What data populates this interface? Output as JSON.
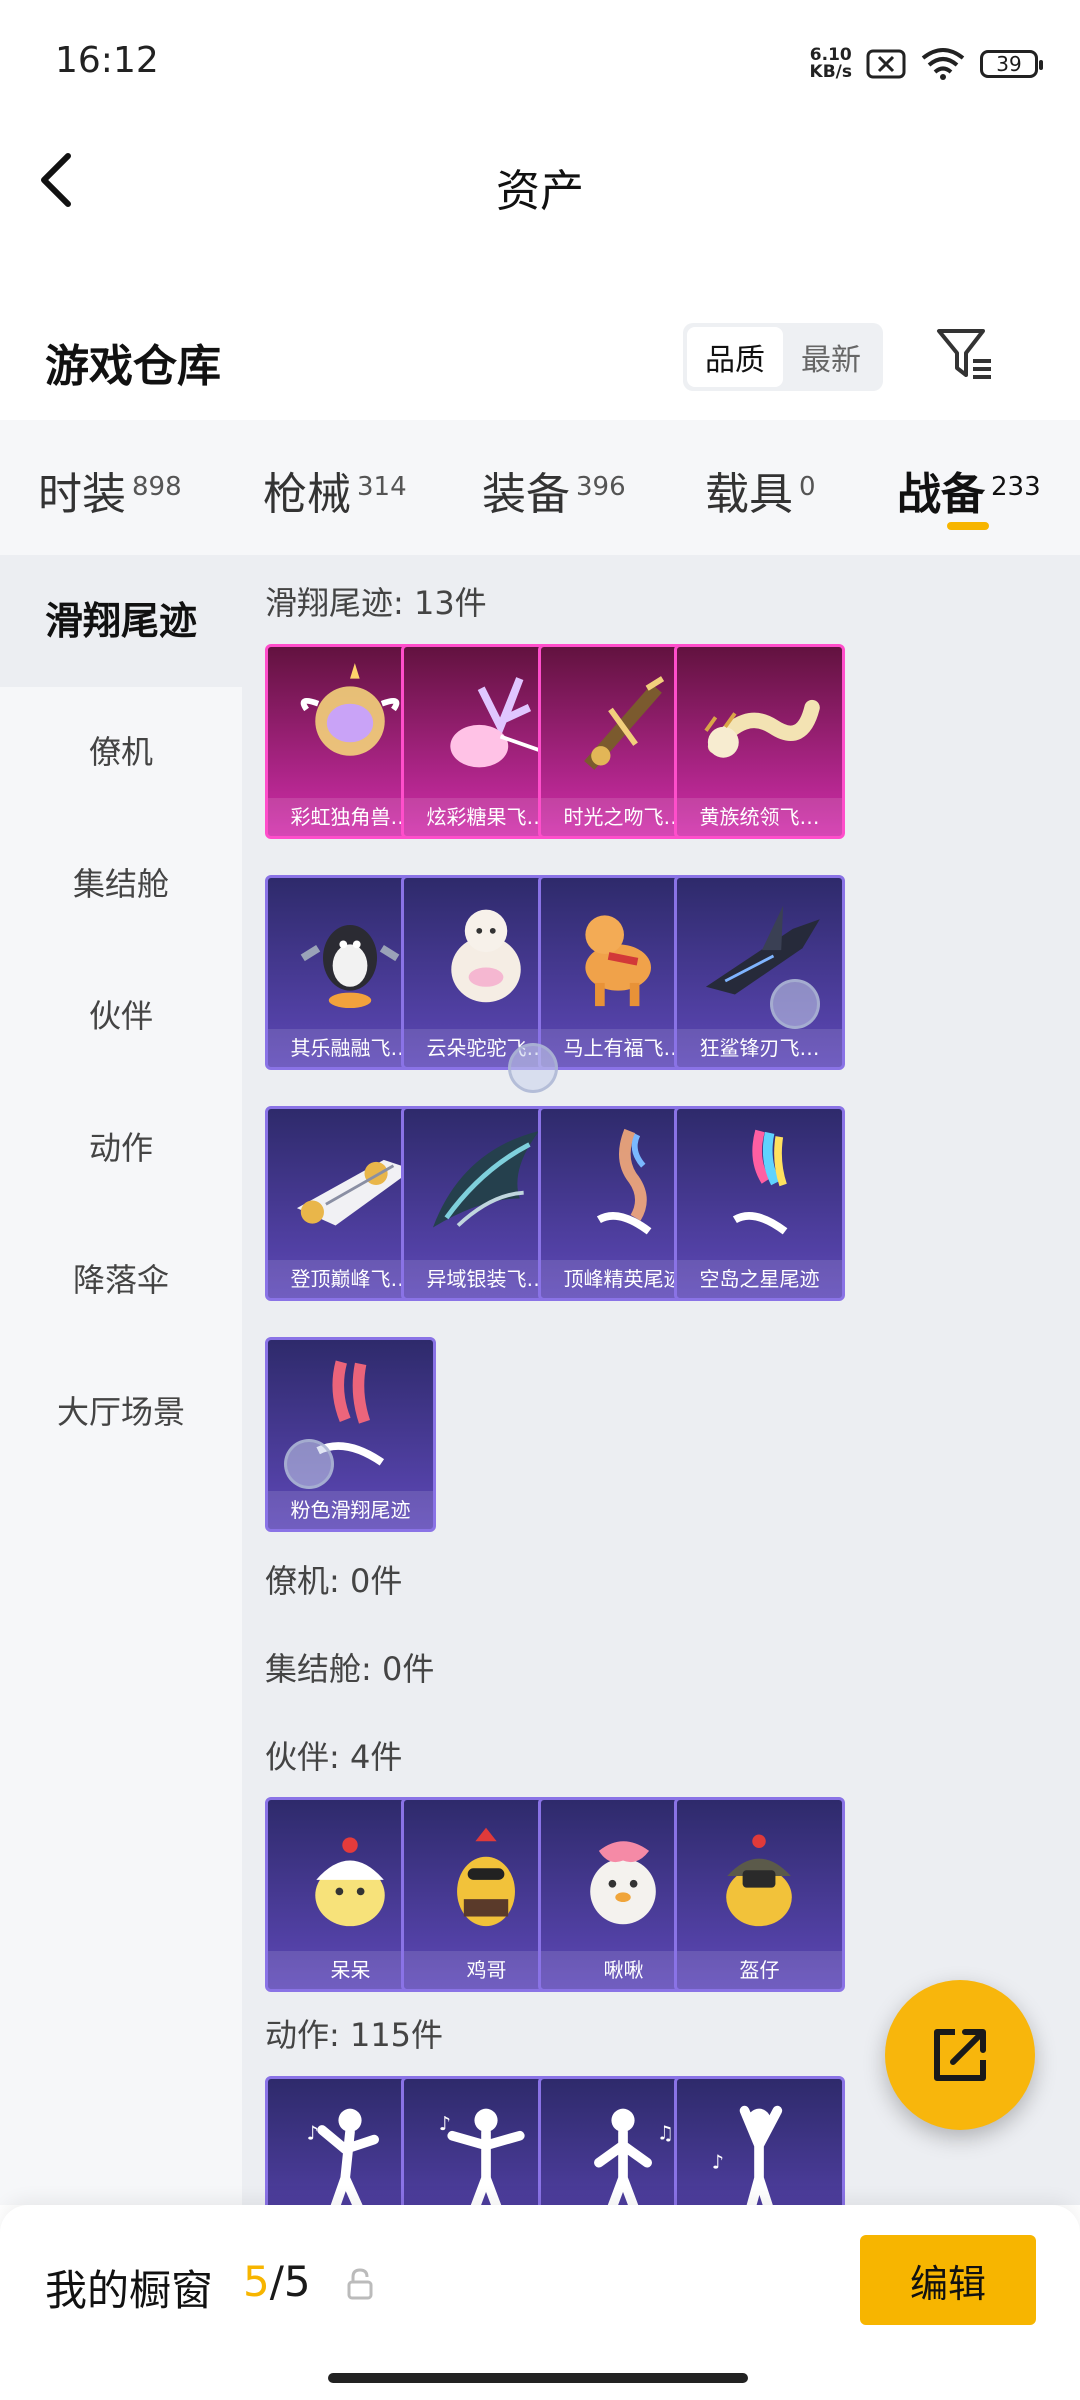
{
  "status_bar": {
    "time": "16:12",
    "net_speed_value": "6.10",
    "net_speed_unit": "KB/s",
    "battery": "39"
  },
  "header": {
    "title": "资产"
  },
  "warehouse": {
    "title": "游戏仓库",
    "sort_options": [
      "品质",
      "最新"
    ],
    "active_sort": "品质"
  },
  "category_tabs": [
    {
      "label": "时装",
      "count": "898"
    },
    {
      "label": "枪械",
      "count": "314"
    },
    {
      "label": "装备",
      "count": "396"
    },
    {
      "label": "载具",
      "count": "0"
    },
    {
      "label": "战备",
      "count": "233",
      "active": true
    }
  ],
  "sidebar": {
    "items": [
      "滑翔尾迹",
      "僚机",
      "集结舱",
      "伙伴",
      "动作",
      "降落伞",
      "大厅场景"
    ],
    "active": "滑翔尾迹"
  },
  "sections": {
    "glide_trail": {
      "header": "滑翔尾迹: 13件",
      "items": [
        "彩虹独角兽…",
        "炫彩糖果飞…",
        "时光之吻飞…",
        "黄族统领飞…",
        "其乐融融飞…",
        "云朵驼驼飞…",
        "马上有福飞…",
        "狂鲨锋刃飞…",
        "登顶巅峰飞…",
        "异域银装飞…",
        "顶峰精英尾迹",
        "空岛之星尾迹",
        "粉色滑翔尾迹"
      ]
    },
    "wingman": {
      "header": "僚机: 0件"
    },
    "capsule": {
      "header": "集结舱: 0件"
    },
    "companion": {
      "header": "伙伴: 4件",
      "items": [
        "呆呆",
        "鸡哥",
        "啾啾",
        "盔仔"
      ]
    },
    "emote": {
      "header": "动作: 115件"
    }
  },
  "bottom_bar": {
    "label": "我的橱窗",
    "used": "5",
    "total": "5",
    "edit_label": "编辑"
  },
  "colors": {
    "accent": "#f7b500",
    "legendary_border": "#ff4ecb",
    "epic_border": "#8a73e6"
  }
}
